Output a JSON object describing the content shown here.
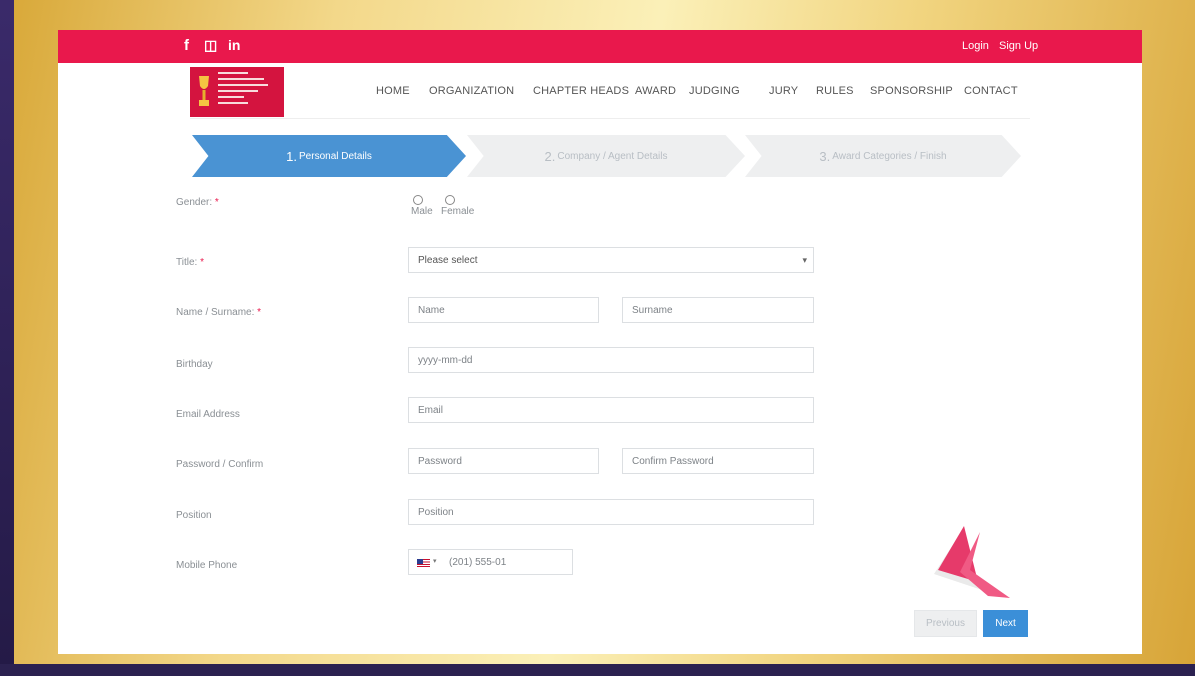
{
  "social": {
    "facebook": "f",
    "instagram": "◫",
    "linkedin": "in"
  },
  "auth": {
    "login": "Login",
    "signup": "Sign Up"
  },
  "nav": [
    "HOME",
    "ORGANIZATION",
    "CHAPTER HEADS",
    "AWARD",
    "JUDGING",
    "JURY",
    "RULES",
    "SPONSORSHIP",
    "CONTACT"
  ],
  "steps": [
    {
      "num": "1.",
      "label": "Personal Details",
      "active": true
    },
    {
      "num": "2.",
      "label": "Company / Agent Details",
      "active": false
    },
    {
      "num": "3.",
      "label": "Award Categories / Finish",
      "active": false
    }
  ],
  "form": {
    "gender": {
      "label": "Gender:",
      "required": "*",
      "options": [
        "Male",
        "Female"
      ]
    },
    "title": {
      "label": "Title:",
      "required": "*",
      "value": "Please select"
    },
    "name": {
      "label": "Name / Surname:",
      "required": "*",
      "name_placeholder": "Name",
      "surname_placeholder": "Surname"
    },
    "birthday": {
      "label": "Birthday",
      "placeholder": "yyyy-mm-dd"
    },
    "email": {
      "label": "Email Address",
      "placeholder": "Email"
    },
    "password": {
      "label": "Password / Confirm",
      "password_placeholder": "Password",
      "confirm_placeholder": "Confirm Password"
    },
    "position": {
      "label": "Position",
      "placeholder": "Position"
    },
    "mobile": {
      "label": "Mobile Phone",
      "placeholder": "(201) 555-01",
      "country_caret": "▾"
    }
  },
  "buttons": {
    "previous": "Previous",
    "next": "Next"
  },
  "colors": {
    "brand": "#e9184c",
    "step_active": "#4a93d3",
    "next_button": "#3b8fd8"
  }
}
